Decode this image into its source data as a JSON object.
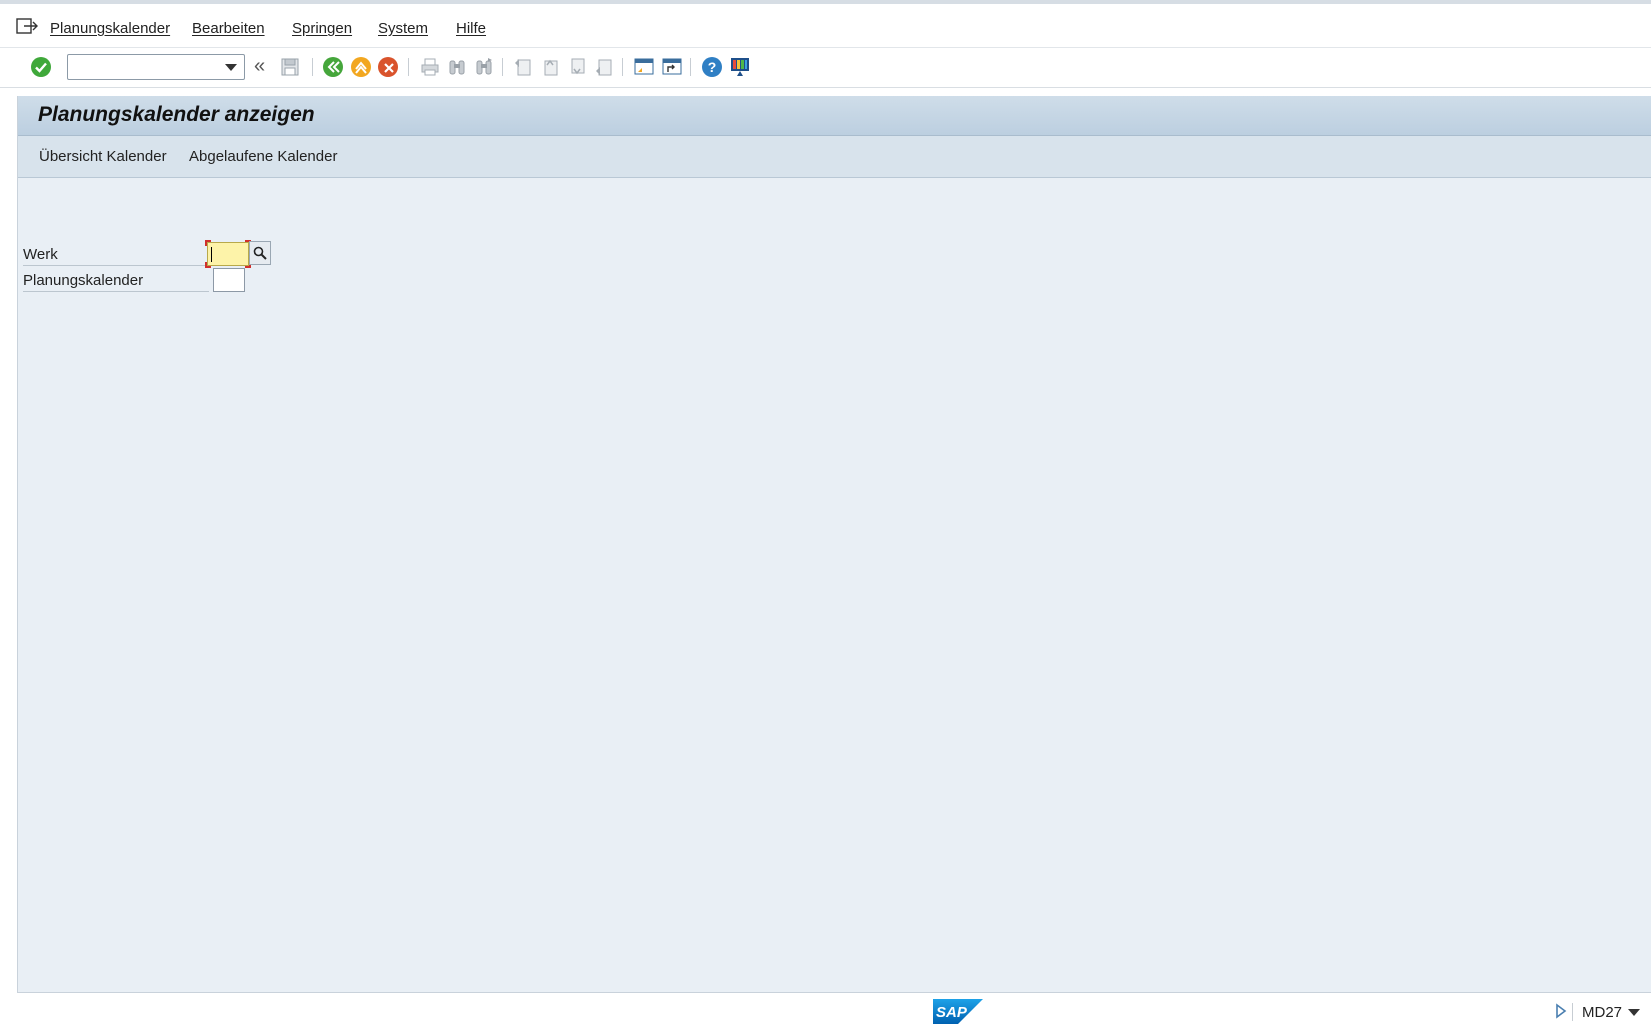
{
  "menubar": {
    "items": [
      {
        "label": "Planungskalender"
      },
      {
        "label": "Bearbeiten"
      },
      {
        "label": "Springen"
      },
      {
        "label": "System"
      },
      {
        "label": "Hilfe"
      }
    ]
  },
  "toolbar": {
    "command_field_value": "",
    "icons": [
      "enter-check-icon",
      "command-dropdown",
      "collapse-chevron-icon",
      "save-icon",
      "back-icon",
      "exit-icon",
      "cancel-icon",
      "print-icon",
      "find-icon",
      "find-next-icon",
      "first-page-icon",
      "previous-page-icon",
      "next-page-icon",
      "last-page-icon",
      "create-session-icon",
      "create-shortcut-icon",
      "help-icon",
      "customize-layout-icon"
    ]
  },
  "screen": {
    "title": "Planungskalender anzeigen",
    "app_toolbar": {
      "btn1": "Übersicht Kalender",
      "btn2": "Abgelaufene Kalender"
    }
  },
  "form": {
    "werk": {
      "label": "Werk",
      "value": ""
    },
    "planungskalender": {
      "label": "Planungskalender",
      "value": ""
    }
  },
  "status": {
    "transaction": "MD27",
    "logo_text": "SAP"
  },
  "colors": {
    "frame_bg": "#e9eff5",
    "title_bar": "#c4d5e4",
    "required_field": "#fdf3a9",
    "focus_marker": "#d0302c"
  }
}
